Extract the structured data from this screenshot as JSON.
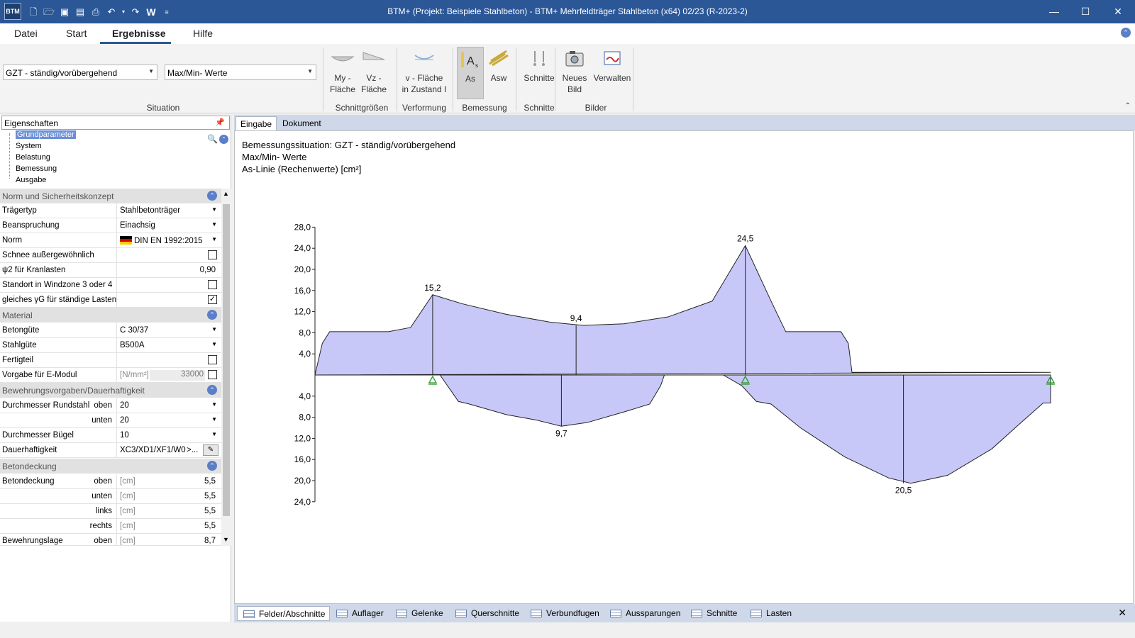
{
  "app": {
    "title": "BTM+ (Projekt: Beispiele Stahlbeton) - BTM+ Mehrfeldträger Stahlbeton (x64) 02/23 (R-2023-2)",
    "logo": "BTM",
    "qat_word": "W",
    "accent": "#2b5797"
  },
  "menu": {
    "tabs": [
      "Datei",
      "Start",
      "Ergebnisse",
      "Hilfe"
    ],
    "active": "Ergebnisse"
  },
  "ribbon": {
    "situation_value": "GZT - ständig/vorübergehend",
    "values_value": "Max/Min- Werte",
    "groups": {
      "situation": "Situation",
      "schnittgroessen": "Schnittgrößen",
      "verformung": "Verformung",
      "bemessung": "Bemessung",
      "schnitte": "Schnitte",
      "bilder": "Bilder"
    },
    "buttons": {
      "my_flaeche": [
        "My -",
        "Fläche"
      ],
      "vz_flaeche": [
        "Vz -",
        "Fläche"
      ],
      "v_flaeche": [
        "v - Fläche",
        "in Zustand I"
      ],
      "as": "As",
      "asw": "Asw",
      "schnitte": "Schnitte",
      "neues_bild": [
        "Neues",
        "Bild"
      ],
      "verwalten": "Verwalten"
    }
  },
  "properties": {
    "header": "Eigenschaften",
    "tree": [
      "Grundparameter",
      "System",
      "Belastung",
      "Bemessung",
      "Ausgabe"
    ],
    "sections": {
      "norm": "Norm und Sicherheitskonzept",
      "material": "Material",
      "bewehrung": "Bewehrungsvorgaben/Dauerhaftigkeit",
      "betondeckung": "Betondeckung"
    },
    "rows": {
      "traegertyp": {
        "label": "Trägertyp",
        "value": "Stahlbetonträger"
      },
      "beanspruchung": {
        "label": "Beanspruchung",
        "value": "Einachsig"
      },
      "norm": {
        "label": "Norm",
        "value": "DIN EN 1992:2015"
      },
      "schnee": {
        "label": "Schnee außergewöhnlich"
      },
      "psi2": {
        "label": "ψ2 für Kranlasten",
        "value": "0,90"
      },
      "windzone": {
        "label": "Standort in Windzone 3 oder 4"
      },
      "gleiches": {
        "label": "gleiches γG für ständige Lasten"
      },
      "betonguete": {
        "label": "Betongüte",
        "value": "C 30/37"
      },
      "stahlguete": {
        "label": "Stahlgüte",
        "value": "B500A"
      },
      "fertigteil": {
        "label": "Fertigteil"
      },
      "emodul": {
        "label": "Vorgabe für E-Modul",
        "unit": "[N/mm²]",
        "value": "33000"
      },
      "rund_oben": {
        "label": "Durchmesser Rundstahl",
        "sub": "oben",
        "value": "20"
      },
      "rund_unten": {
        "sub": "unten",
        "value": "20"
      },
      "buegel": {
        "label": "Durchmesser Bügel",
        "value": "10"
      },
      "dauer": {
        "label": "Dauerhaftigkeit",
        "value": "XC3/XD1/XF1/W0",
        "more": ">..."
      },
      "bd_oben": {
        "label": "Betondeckung",
        "sub": "oben",
        "unit": "[cm]",
        "value": "5,5"
      },
      "bd_unten": {
        "sub": "unten",
        "unit": "[cm]",
        "value": "5,5"
      },
      "bd_links": {
        "sub": "links",
        "unit": "[cm]",
        "value": "5,5"
      },
      "bd_rechts": {
        "sub": "rechts",
        "unit": "[cm]",
        "value": "5,5"
      },
      "bl_oben": {
        "label": "Bewehrungslage",
        "sub": "oben",
        "unit": "[cm]",
        "value": "8,7"
      }
    },
    "checks": {
      "schnee": false,
      "windzone": false,
      "gleiches": true,
      "fertigteil": false,
      "emodul": false
    }
  },
  "doc_tabs": [
    "Eingabe",
    "Dokument"
  ],
  "main": {
    "line1": "Bemessungssituation: GZT - ständig/vorübergehend",
    "line2": "Max/Min- Werte",
    "line3": "As-Linie (Rechenwerte) [cm²]"
  },
  "chart_data": {
    "type": "area",
    "y_ticks_top": [
      "28,0",
      "24,0",
      "20,0",
      "16,0",
      "12,0",
      "8,0",
      "4,0"
    ],
    "y_ticks_bottom": [
      "4,0",
      "8,0",
      "12,0",
      "16,0",
      "20,0",
      "24,0"
    ],
    "ylim": [
      -24,
      28
    ],
    "labels": [
      "15,2",
      "9,4",
      "24,5",
      "9,7",
      "20,5"
    ],
    "fill_color": "#c8c8f8",
    "top_series": [
      [
        0,
        0
      ],
      [
        0.01,
        6
      ],
      [
        0.02,
        8.2
      ],
      [
        0.1,
        8.2
      ],
      [
        0.13,
        9
      ],
      [
        0.16,
        15.2
      ],
      [
        0.2,
        13.5
      ],
      [
        0.26,
        11.5
      ],
      [
        0.32,
        10
      ],
      [
        0.365,
        9.4
      ],
      [
        0.42,
        9.7
      ],
      [
        0.48,
        11
      ],
      [
        0.51,
        12.5
      ],
      [
        0.54,
        14
      ],
      [
        0.585,
        24.5
      ],
      [
        0.62,
        14
      ],
      [
        0.64,
        8.2
      ],
      [
        0.7,
        8.2
      ],
      [
        0.715,
        8.2
      ],
      [
        0.725,
        6
      ],
      [
        0.73,
        0.5
      ],
      [
        1,
        0.5
      ]
    ],
    "bottom_series": [
      [
        0.17,
        0
      ],
      [
        0.195,
        -5
      ],
      [
        0.21,
        -5.5
      ],
      [
        0.26,
        -7.5
      ],
      [
        0.3,
        -8.5
      ],
      [
        0.335,
        -9.7
      ],
      [
        0.37,
        -9
      ],
      [
        0.42,
        -7
      ],
      [
        0.455,
        -5.5
      ],
      [
        0.47,
        -2
      ],
      [
        0.475,
        0
      ],
      [
        0.555,
        0
      ],
      [
        0.58,
        -2
      ],
      [
        0.6,
        -5
      ],
      [
        0.62,
        -5.5
      ],
      [
        0.66,
        -10
      ],
      [
        0.72,
        -15.5
      ],
      [
        0.78,
        -19.5
      ],
      [
        0.81,
        -20.5
      ],
      [
        0.86,
        -19
      ],
      [
        0.92,
        -14
      ],
      [
        0.96,
        -9
      ],
      [
        0.99,
        -5.3
      ],
      [
        1,
        -5.3
      ],
      [
        1,
        0
      ]
    ],
    "verticals": [
      {
        "x": 0.16,
        "y": 15.2
      },
      {
        "x": 0.355,
        "y": 9.4
      },
      {
        "x": 0.585,
        "y": 24.5
      },
      {
        "x": 0.335,
        "y": -9.7
      },
      {
        "x": 0.8,
        "y": -20.5
      }
    ],
    "supports": [
      0.16,
      0.585,
      1.0
    ]
  },
  "bottom_tabs": [
    "Felder/Abschnitte",
    "Auflager",
    "Gelenke",
    "Querschnitte",
    "Verbundfugen",
    "Aussparungen",
    "Schnitte",
    "Lasten"
  ]
}
